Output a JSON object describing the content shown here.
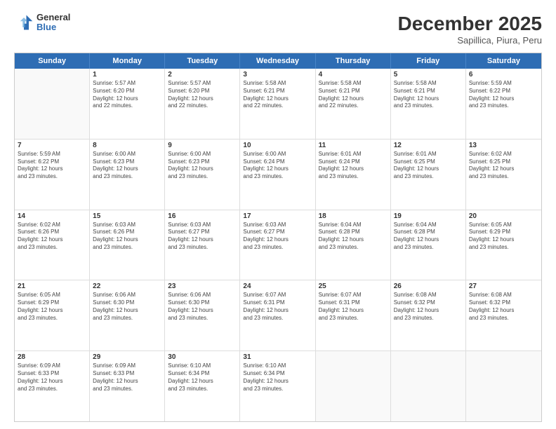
{
  "logo": {
    "line1": "General",
    "line2": "Blue"
  },
  "header": {
    "month": "December 2025",
    "location": "Sapillica, Piura, Peru"
  },
  "days": [
    "Sunday",
    "Monday",
    "Tuesday",
    "Wednesday",
    "Thursday",
    "Friday",
    "Saturday"
  ],
  "weeks": [
    [
      {
        "day": "",
        "info": ""
      },
      {
        "day": "1",
        "info": "Sunrise: 5:57 AM\nSunset: 6:20 PM\nDaylight: 12 hours\nand 22 minutes."
      },
      {
        "day": "2",
        "info": "Sunrise: 5:57 AM\nSunset: 6:20 PM\nDaylight: 12 hours\nand 22 minutes."
      },
      {
        "day": "3",
        "info": "Sunrise: 5:58 AM\nSunset: 6:21 PM\nDaylight: 12 hours\nand 22 minutes."
      },
      {
        "day": "4",
        "info": "Sunrise: 5:58 AM\nSunset: 6:21 PM\nDaylight: 12 hours\nand 22 minutes."
      },
      {
        "day": "5",
        "info": "Sunrise: 5:58 AM\nSunset: 6:21 PM\nDaylight: 12 hours\nand 23 minutes."
      },
      {
        "day": "6",
        "info": "Sunrise: 5:59 AM\nSunset: 6:22 PM\nDaylight: 12 hours\nand 23 minutes."
      }
    ],
    [
      {
        "day": "7",
        "info": "Sunrise: 5:59 AM\nSunset: 6:22 PM\nDaylight: 12 hours\nand 23 minutes."
      },
      {
        "day": "8",
        "info": "Sunrise: 6:00 AM\nSunset: 6:23 PM\nDaylight: 12 hours\nand 23 minutes."
      },
      {
        "day": "9",
        "info": "Sunrise: 6:00 AM\nSunset: 6:23 PM\nDaylight: 12 hours\nand 23 minutes."
      },
      {
        "day": "10",
        "info": "Sunrise: 6:00 AM\nSunset: 6:24 PM\nDaylight: 12 hours\nand 23 minutes."
      },
      {
        "day": "11",
        "info": "Sunrise: 6:01 AM\nSunset: 6:24 PM\nDaylight: 12 hours\nand 23 minutes."
      },
      {
        "day": "12",
        "info": "Sunrise: 6:01 AM\nSunset: 6:25 PM\nDaylight: 12 hours\nand 23 minutes."
      },
      {
        "day": "13",
        "info": "Sunrise: 6:02 AM\nSunset: 6:25 PM\nDaylight: 12 hours\nand 23 minutes."
      }
    ],
    [
      {
        "day": "14",
        "info": "Sunrise: 6:02 AM\nSunset: 6:26 PM\nDaylight: 12 hours\nand 23 minutes."
      },
      {
        "day": "15",
        "info": "Sunrise: 6:03 AM\nSunset: 6:26 PM\nDaylight: 12 hours\nand 23 minutes."
      },
      {
        "day": "16",
        "info": "Sunrise: 6:03 AM\nSunset: 6:27 PM\nDaylight: 12 hours\nand 23 minutes."
      },
      {
        "day": "17",
        "info": "Sunrise: 6:03 AM\nSunset: 6:27 PM\nDaylight: 12 hours\nand 23 minutes."
      },
      {
        "day": "18",
        "info": "Sunrise: 6:04 AM\nSunset: 6:28 PM\nDaylight: 12 hours\nand 23 minutes."
      },
      {
        "day": "19",
        "info": "Sunrise: 6:04 AM\nSunset: 6:28 PM\nDaylight: 12 hours\nand 23 minutes."
      },
      {
        "day": "20",
        "info": "Sunrise: 6:05 AM\nSunset: 6:29 PM\nDaylight: 12 hours\nand 23 minutes."
      }
    ],
    [
      {
        "day": "21",
        "info": "Sunrise: 6:05 AM\nSunset: 6:29 PM\nDaylight: 12 hours\nand 23 minutes."
      },
      {
        "day": "22",
        "info": "Sunrise: 6:06 AM\nSunset: 6:30 PM\nDaylight: 12 hours\nand 23 minutes."
      },
      {
        "day": "23",
        "info": "Sunrise: 6:06 AM\nSunset: 6:30 PM\nDaylight: 12 hours\nand 23 minutes."
      },
      {
        "day": "24",
        "info": "Sunrise: 6:07 AM\nSunset: 6:31 PM\nDaylight: 12 hours\nand 23 minutes."
      },
      {
        "day": "25",
        "info": "Sunrise: 6:07 AM\nSunset: 6:31 PM\nDaylight: 12 hours\nand 23 minutes."
      },
      {
        "day": "26",
        "info": "Sunrise: 6:08 AM\nSunset: 6:32 PM\nDaylight: 12 hours\nand 23 minutes."
      },
      {
        "day": "27",
        "info": "Sunrise: 6:08 AM\nSunset: 6:32 PM\nDaylight: 12 hours\nand 23 minutes."
      }
    ],
    [
      {
        "day": "28",
        "info": "Sunrise: 6:09 AM\nSunset: 6:33 PM\nDaylight: 12 hours\nand 23 minutes."
      },
      {
        "day": "29",
        "info": "Sunrise: 6:09 AM\nSunset: 6:33 PM\nDaylight: 12 hours\nand 23 minutes."
      },
      {
        "day": "30",
        "info": "Sunrise: 6:10 AM\nSunset: 6:34 PM\nDaylight: 12 hours\nand 23 minutes."
      },
      {
        "day": "31",
        "info": "Sunrise: 6:10 AM\nSunset: 6:34 PM\nDaylight: 12 hours\nand 23 minutes."
      },
      {
        "day": "",
        "info": ""
      },
      {
        "day": "",
        "info": ""
      },
      {
        "day": "",
        "info": ""
      }
    ]
  ]
}
